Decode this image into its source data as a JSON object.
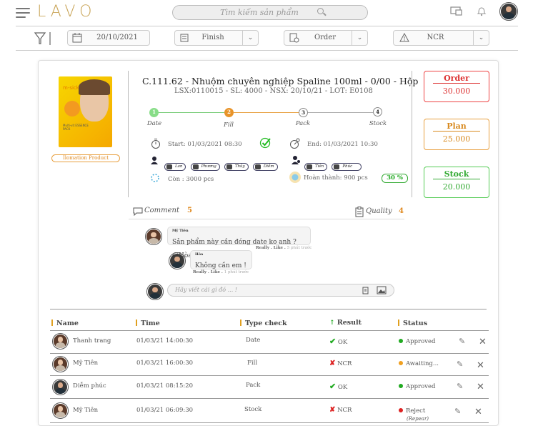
{
  "header": {
    "logo": "LAVO",
    "search_placeholder": "Tìm kiếm sản phẩm"
  },
  "filters": {
    "date": "20/10/2021",
    "stage": "Finish",
    "type": "Order",
    "issue": "NCR"
  },
  "product": {
    "image_caption": "Ilomation Product",
    "title": "C.111.62 - Nhuộm chuyên nghiệp Spaline 100ml - 0/00 - Hộp",
    "subtitle": "LSX:0110015 - SL: 4000 - NSX: 20/10/21 - LOT: E0108",
    "pack_brand": "m-sick",
    "pack_text": "Multi-vit ESSENCE PACK"
  },
  "steps": [
    {
      "num": "1",
      "label": "Date",
      "state": "done"
    },
    {
      "num": "2",
      "label": "Fill",
      "state": "active"
    },
    {
      "num": "3",
      "label": "Pack",
      "state": "todo"
    },
    {
      "num": "4",
      "label": "Stock",
      "state": "todo"
    }
  ],
  "timing": {
    "start": "Start: 01/03/2021 08:30",
    "end": "End: 01/03/2021 10:30"
  },
  "team": {
    "left": [
      "Lan",
      "Phương",
      "Thủy",
      "Diễm"
    ],
    "right": [
      "Tiên",
      "Phúc"
    ]
  },
  "progress": {
    "remaining": "Còn : 3000 pcs",
    "done": "Hoàn thành: 900 pcs",
    "percent": "30 %"
  },
  "stats": [
    {
      "label": "Order",
      "value": "30.000",
      "color": "#d33"
    },
    {
      "label": "Plan",
      "value": "25.000",
      "color": "#e8a040"
    },
    {
      "label": "Stock",
      "value": "20.000",
      "color": "#3a3"
    }
  ],
  "tabs": {
    "comment": "Comment",
    "comment_count": "5",
    "quality": "Quality",
    "quality_count": "4"
  },
  "comments": [
    {
      "author": "Mỹ Tiên",
      "text": "Sản phẩm này cần đóng date ko anh ? @Hòa",
      "actions": "Really . Like .",
      "time": "5 phút trước"
    },
    {
      "author": "Hòa",
      "text": "Không cần em !",
      "actions": "Really . Like .",
      "time": "1 phút trước"
    }
  ],
  "comment_input_placeholder": "Hãy viết cái gì đó ... !",
  "table": {
    "headers": [
      "Name",
      "Time",
      "Type check",
      "Result",
      "Status"
    ],
    "rows": [
      {
        "name": "Thanh trang",
        "time": "01/03/21 14:00:30",
        "type": "Date",
        "result": "OK",
        "status": "Approved",
        "status_color": "#2a2",
        "note": ""
      },
      {
        "name": "Mỹ Tiên",
        "time": "01/03/21 16:00:30",
        "type": "Fill",
        "result": "NCR",
        "status": "Awaiting...",
        "status_color": "#f0a020",
        "note": ""
      },
      {
        "name": "Diễm phúc",
        "time": "01/03/21 08:15:20",
        "type": "Pack",
        "result": "OK",
        "status": "Approved",
        "status_color": "#2a2",
        "note": ""
      },
      {
        "name": "Mỹ Tiên",
        "time": "01/03/21 06:09:30",
        "type": "Stock",
        "result": "NCR",
        "status": "Reject",
        "status_color": "#d22",
        "note": "(Repear)"
      }
    ]
  }
}
